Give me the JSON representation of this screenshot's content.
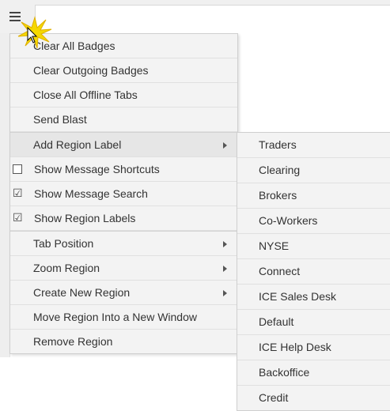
{
  "toolbar": {
    "menu_icon": "hamburger-menu-icon",
    "cursor_icon": "click-highlight-icon"
  },
  "menu": {
    "items": [
      {
        "label": "Clear All Badges"
      },
      {
        "label": "Clear Outgoing Badges"
      },
      {
        "label": "Close All Offline Tabs"
      },
      {
        "label": "Send Blast"
      },
      {
        "label": "Add Region Label",
        "has_submenu": true,
        "highlighted": true
      },
      {
        "label": "Show Message Shortcuts",
        "checked": false
      },
      {
        "label": "Show Message Search",
        "checked": true
      },
      {
        "label": "Show Region Labels",
        "checked": true
      },
      {
        "label": "Tab Position",
        "has_submenu": true
      },
      {
        "label": "Zoom Region",
        "has_submenu": true
      },
      {
        "label": "Create New Region",
        "has_submenu": true
      },
      {
        "label": "Move Region Into a New Window"
      },
      {
        "label": "Remove Region"
      }
    ]
  },
  "submenu": {
    "parent": "Add Region Label",
    "items": [
      {
        "label": "Traders"
      },
      {
        "label": "Clearing"
      },
      {
        "label": "Brokers"
      },
      {
        "label": "Co-Workers"
      },
      {
        "label": "NYSE"
      },
      {
        "label": "Connect"
      },
      {
        "label": "ICE Sales Desk"
      },
      {
        "label": "Default"
      },
      {
        "label": "ICE Help Desk"
      },
      {
        "label": "Backoffice"
      },
      {
        "label": "Credit"
      }
    ]
  },
  "colors": {
    "menu_bg": "#f3f3f3",
    "highlight_bg": "#e6e6e6",
    "burst": "#f5d800"
  }
}
